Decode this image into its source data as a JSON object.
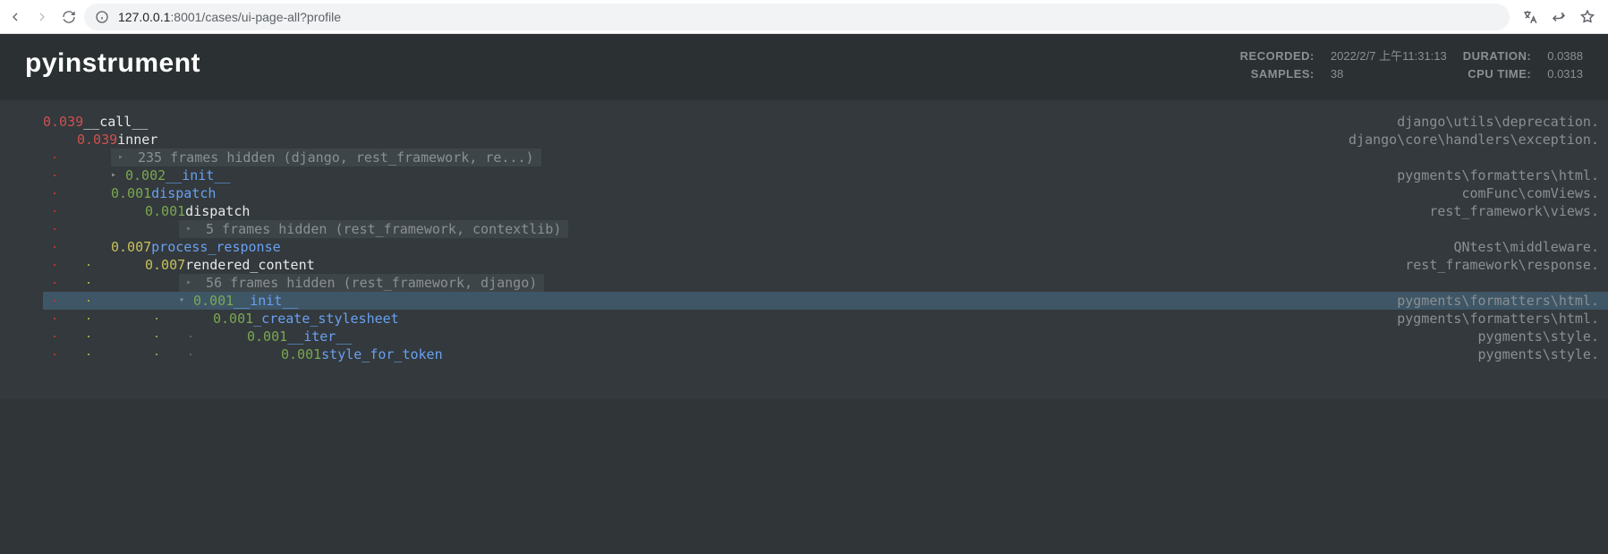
{
  "browser": {
    "url_host": "127.0.0.1",
    "url_path": ":8001/cases/ui-page-all?profile"
  },
  "header": {
    "title": "pyinstrument",
    "recorded_label": "RECORDED:",
    "recorded_value": "2022/2/7 上午11:31:13",
    "duration_label": "DURATION:",
    "duration_value": "0.0388",
    "samples_label": "SAMPLES:",
    "samples_value": "38",
    "cputime_label": "CPU TIME:",
    "cputime_value": "0.0313"
  },
  "tree": {
    "rows": [
      {
        "depth": 0,
        "time": "0.039",
        "timeClass": "t-red",
        "name": "__call__",
        "nameClass": "t-white",
        "path": "django\\utils\\deprecation.",
        "guides": []
      },
      {
        "depth": 1,
        "time": "0.039",
        "timeClass": "t-red",
        "name": "inner",
        "nameClass": "t-white",
        "path": "django\\core\\handlers\\exception.",
        "guides": []
      },
      {
        "depth": 2,
        "hidden": true,
        "text": "235 frames hidden (django, rest_framework, re...)",
        "guides": [
          "guide-red"
        ]
      },
      {
        "depth": 2,
        "tri": "▸",
        "time": "0.002",
        "timeClass": "t-green",
        "name": "__init__",
        "nameClass": "t-blue",
        "path": "pygments\\formatters\\html.",
        "guides": [
          "guide-red"
        ]
      },
      {
        "depth": 2,
        "time": "0.001",
        "timeClass": "t-green",
        "name": "dispatch",
        "nameClass": "t-blue",
        "path": "comFunc\\comViews.",
        "guides": [
          "guide-red"
        ]
      },
      {
        "depth": 3,
        "time": "0.001",
        "timeClass": "t-green",
        "name": "dispatch",
        "nameClass": "t-white",
        "path": "rest_framework\\views.",
        "guides": [
          "guide-red",
          ""
        ]
      },
      {
        "depth": 4,
        "hidden": true,
        "text": "5 frames hidden (rest_framework, contextlib)",
        "guides": [
          "guide-red",
          "",
          ""
        ]
      },
      {
        "depth": 2,
        "time": "0.007",
        "timeClass": "t-yellow",
        "name": "process_response",
        "nameClass": "t-blue",
        "path": "QNtest\\middleware.",
        "guides": [
          "guide-red"
        ]
      },
      {
        "depth": 3,
        "time": "0.007",
        "timeClass": "t-yellow",
        "name": "rendered_content",
        "nameClass": "t-white",
        "path": "rest_framework\\response.",
        "guides": [
          "guide-red",
          "guide-yellow"
        ]
      },
      {
        "depth": 4,
        "hidden": true,
        "text": "56 frames hidden (rest_framework, django)",
        "guides": [
          "guide-red",
          "guide-yellow",
          ""
        ]
      },
      {
        "depth": 4,
        "tri": "▾",
        "time": "0.001",
        "timeClass": "t-green",
        "name": "__init__",
        "nameClass": "t-blue",
        "path": "pygments\\formatters\\html.",
        "guides": [
          "guide-red",
          "guide-yellow",
          ""
        ],
        "hl": true
      },
      {
        "depth": 5,
        "time": "0.001",
        "timeClass": "t-green",
        "name": "_create_stylesheet",
        "nameClass": "t-blue",
        "path": "pygments\\formatters\\html.",
        "guides": [
          "guide-red",
          "guide-yellow",
          "",
          "guide-green"
        ]
      },
      {
        "depth": 6,
        "time": "0.001",
        "timeClass": "t-green",
        "name": "__iter__",
        "nameClass": "t-blue",
        "path": "pygments\\style.",
        "guides": [
          "guide-red",
          "guide-yellow",
          "",
          "guide-green",
          "guide-gray"
        ]
      },
      {
        "depth": 7,
        "time": "0.001",
        "timeClass": "t-green",
        "name": "style_for_token",
        "nameClass": "t-blue",
        "path": "pygments\\style.",
        "guides": [
          "guide-red",
          "guide-yellow",
          "",
          "guide-green",
          "guide-gray",
          ""
        ]
      }
    ]
  }
}
